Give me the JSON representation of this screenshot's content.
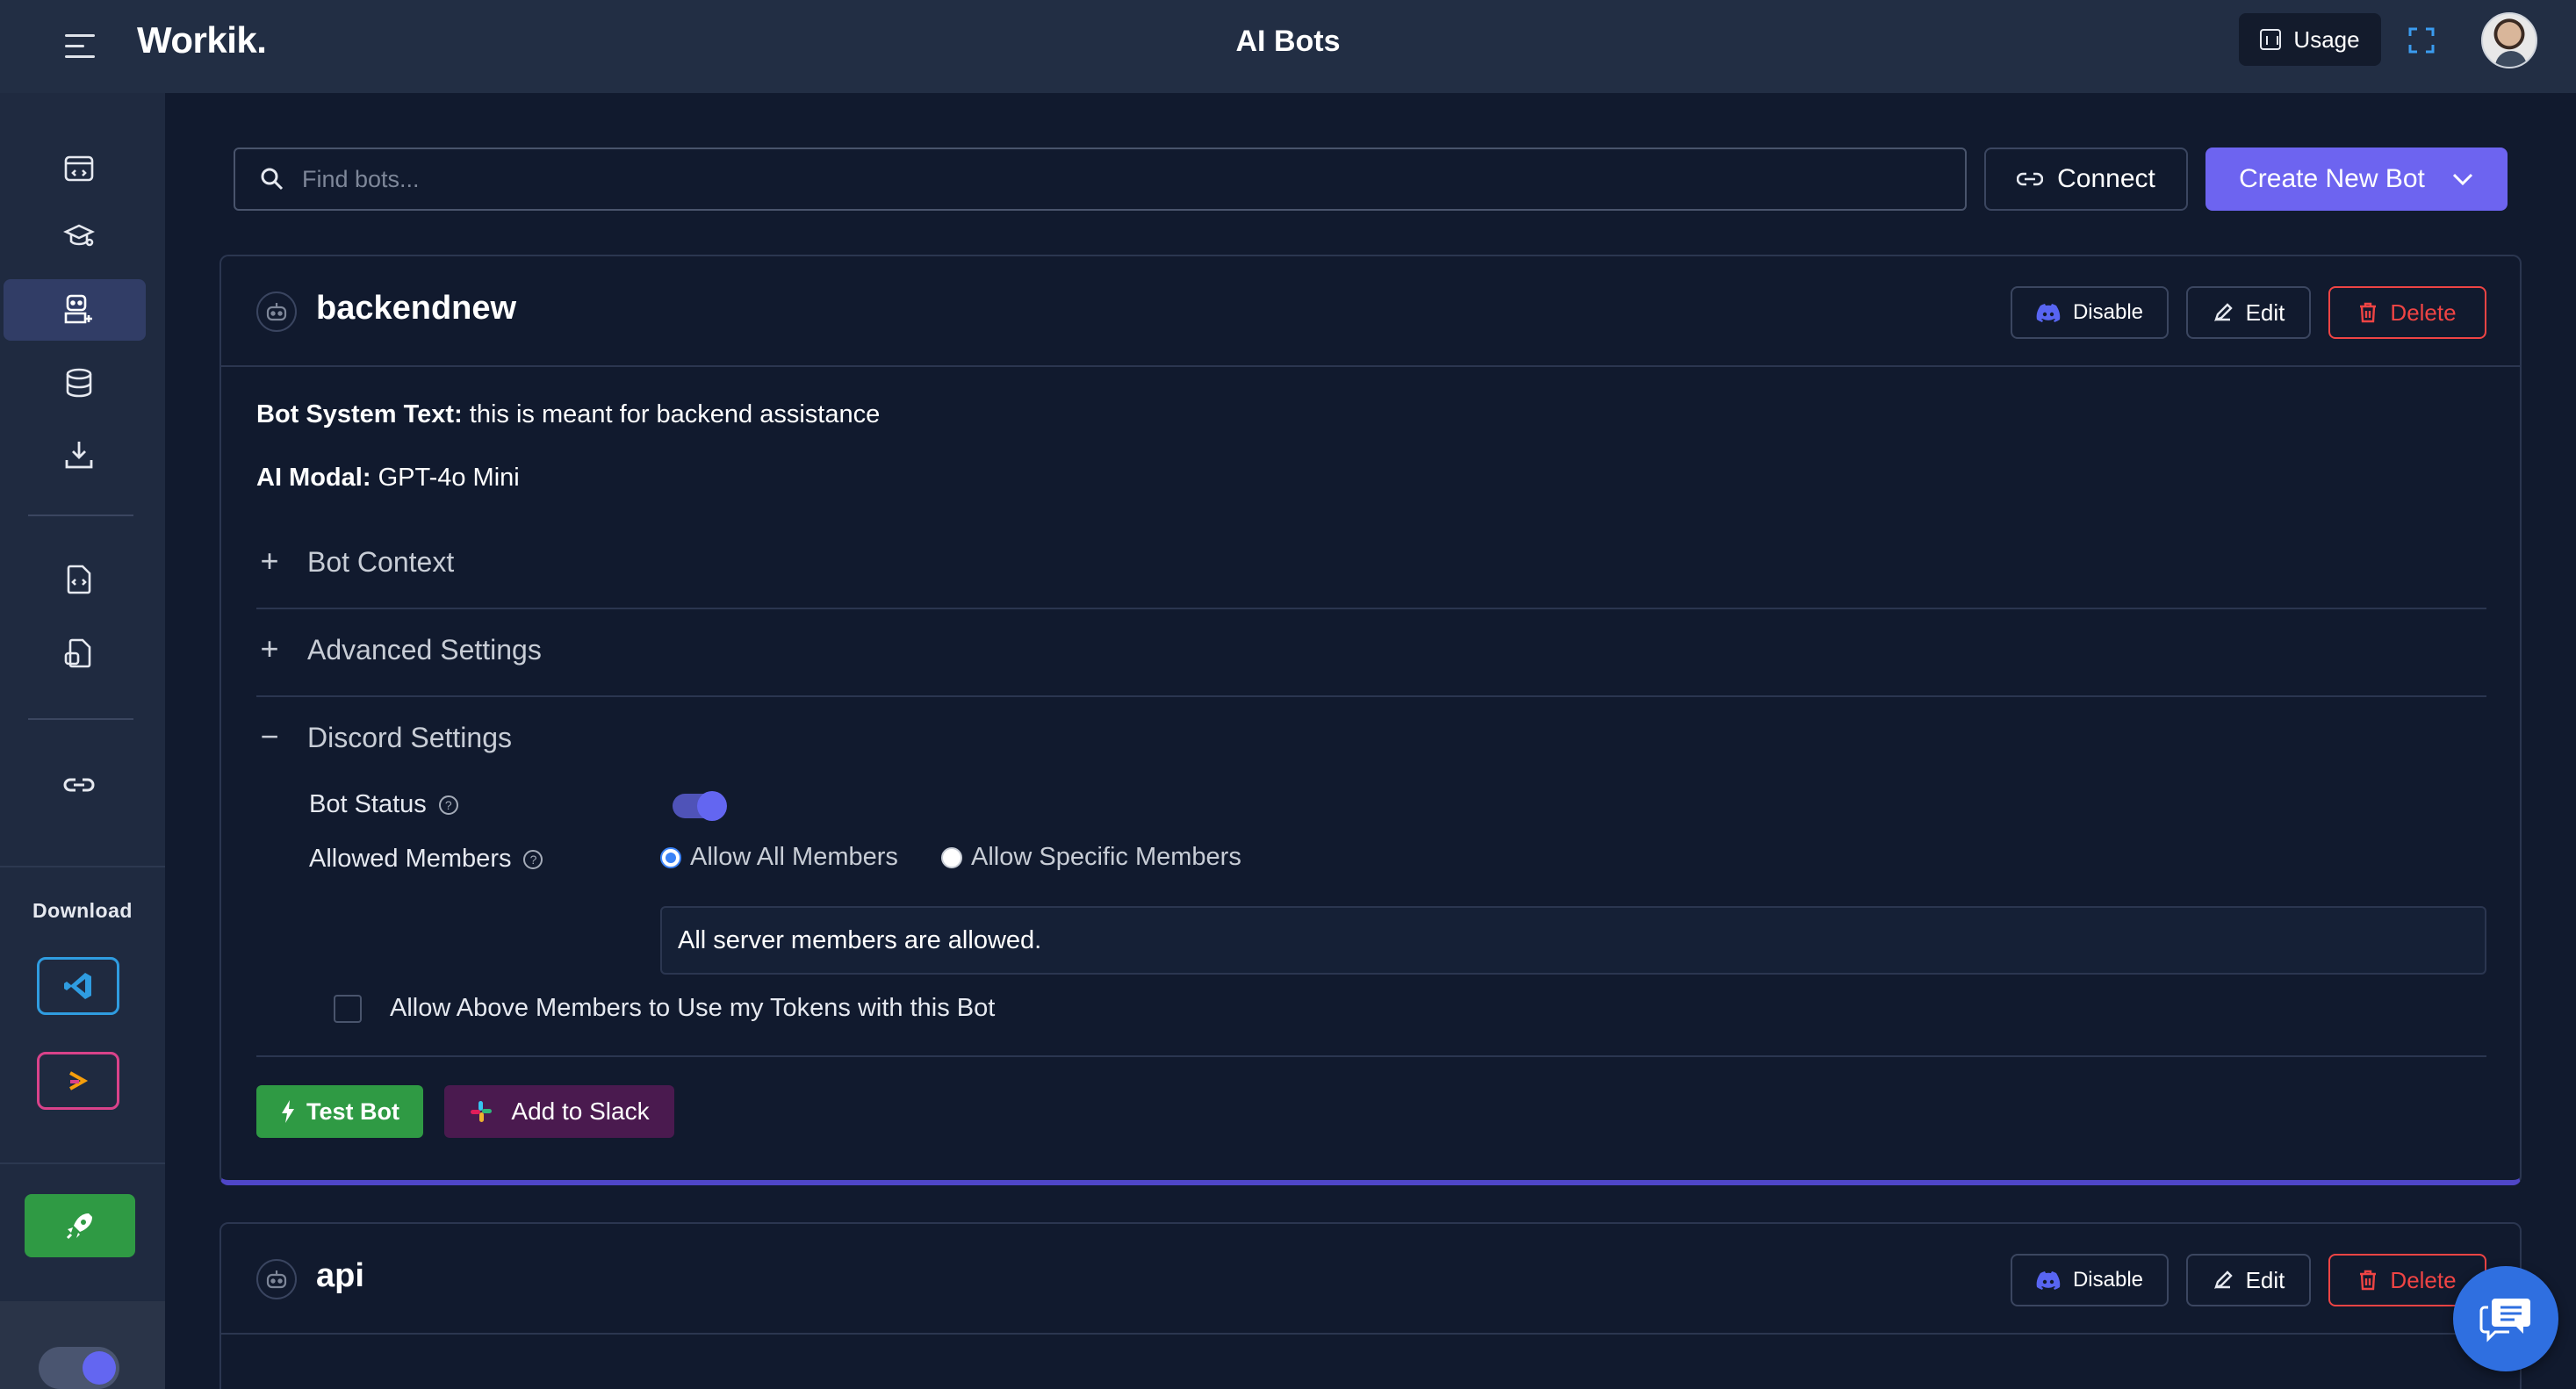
{
  "header": {
    "logo": "Workik.",
    "title": "AI Bots",
    "usage_label": "Usage"
  },
  "sidebar": {
    "download_label": "Download"
  },
  "toolbar": {
    "search_placeholder": "Find bots...",
    "connect_label": "Connect",
    "create_label": "Create New Bot"
  },
  "bots": [
    {
      "name": "backendnew",
      "disable_label": "Disable",
      "edit_label": "Edit",
      "delete_label": "Delete",
      "system_text_label": "Bot System Text:",
      "system_text": "this is meant for backend assistance",
      "ai_modal_label": "AI Modal:",
      "ai_modal": "GPT-4o Mini",
      "sections": {
        "bot_context": "Bot Context",
        "advanced_settings": "Advanced Settings",
        "discord_settings": "Discord Settings"
      },
      "discord": {
        "bot_status_label": "Bot Status",
        "bot_status_enabled": true,
        "allowed_members_label": "Allowed Members",
        "option_all": "Allow All Members",
        "option_specific": "Allow Specific Members",
        "selected_option": "all",
        "allowed_message": "All server members are allowed.",
        "token_checkbox_label": "Allow Above Members to Use my Tokens with this Bot",
        "token_checkbox_checked": false
      },
      "test_label": "Test Bot",
      "slack_label": "Add to Slack"
    },
    {
      "name": "api",
      "disable_label": "Disable",
      "edit_label": "Edit",
      "delete_label": "Delete"
    }
  ],
  "colors": {
    "accent": "#6d64f0",
    "success": "#2f9a44",
    "danger": "#ef4444",
    "slack": "#4a1a4f",
    "header_bg": "#222e44",
    "page_bg": "#111a2e"
  }
}
